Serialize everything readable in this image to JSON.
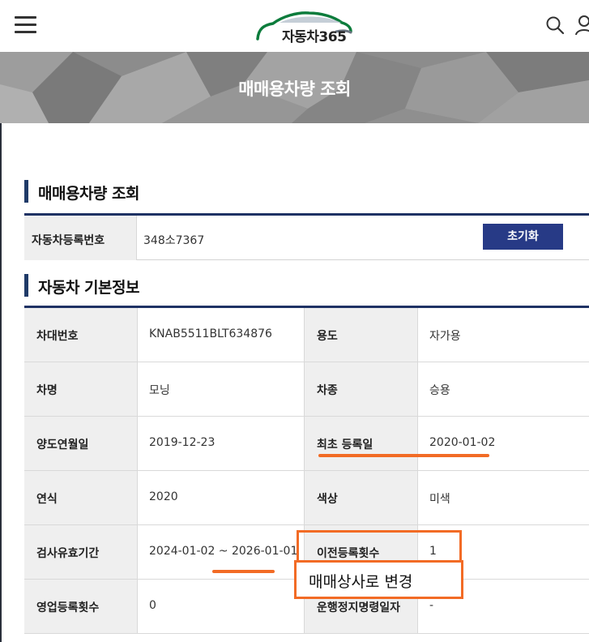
{
  "header": {
    "logo_text": "자동차365",
    "menu_icon": "hamburger-menu-icon",
    "search_icon": "search-icon",
    "user_icon": "user-icon"
  },
  "banner": {
    "title": "매매용차량 조회"
  },
  "search_section": {
    "heading": "매매용차량 조회",
    "field_label": "자동차등록번호",
    "field_value": "348소7367",
    "reset_label": "초기화"
  },
  "info_section": {
    "heading": "자동차 기본정보",
    "rows": [
      {
        "label1": "차대번호",
        "value1": "KNAB5511BLT634876",
        "label2": "용도",
        "value2": "자가용"
      },
      {
        "label1": "차명",
        "value1": "모닝",
        "label2": "차종",
        "value2": "승용"
      },
      {
        "label1": "양도연월일",
        "value1": "2019-12-23",
        "label2": "최초 등록일",
        "value2": "2020-01-02"
      },
      {
        "label1": "연식",
        "value1": "2020",
        "label2": "색상",
        "value2": "미색"
      },
      {
        "label1": "검사유효기간",
        "value1": "2024-01-02 ~ 2026-01-01",
        "label2": "이전등록횟수",
        "value2": "1"
      },
      {
        "label1": "영업등록횟수",
        "value1": "0",
        "label2": "운행정지명령일자",
        "value2": "-"
      }
    ]
  },
  "annotation": {
    "note": "매매상사로 변경",
    "color": "#f26b25"
  },
  "colors": {
    "accent_navy": "#1f3264",
    "button_blue": "#273a86",
    "label_bg": "#efefef"
  }
}
